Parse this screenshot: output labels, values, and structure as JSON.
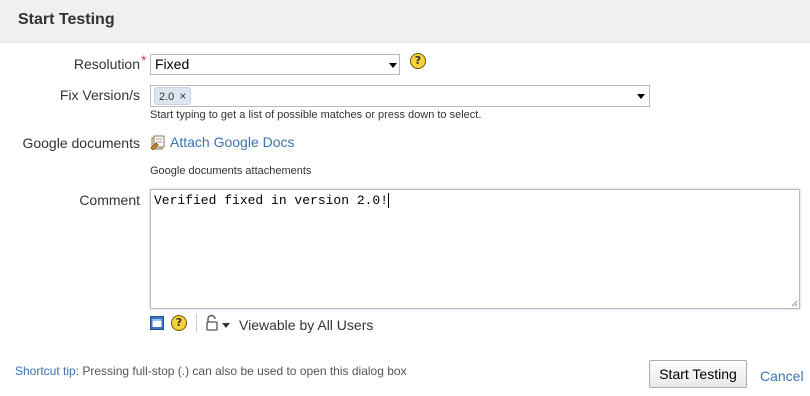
{
  "dialog": {
    "title": "Start Testing"
  },
  "resolution": {
    "label": "Resolution",
    "required_mark": "*",
    "value": "Fixed"
  },
  "fix_version": {
    "label": "Fix Version/s",
    "tags": [
      {
        "text": "2.0",
        "remove": "×"
      }
    ],
    "hint": "Start typing to get a list of possible matches or press down to select."
  },
  "google_docs": {
    "label": "Google documents",
    "link": "Attach Google Docs",
    "hint": "Google documents attachements"
  },
  "comment": {
    "label": "Comment",
    "value": "Verified fixed in version 2.0!",
    "visibility": "Viewable by All Users"
  },
  "help_glyph": "?",
  "footer": {
    "tip_label": "Shortcut tip:",
    "tip_text": "Pressing full-stop (.) can also be used to open this dialog box",
    "submit": "Start Testing",
    "cancel": "Cancel"
  },
  "colors": {
    "link": "#3b73af",
    "required": "#d04437",
    "header_bg": "#f0f0f0"
  }
}
